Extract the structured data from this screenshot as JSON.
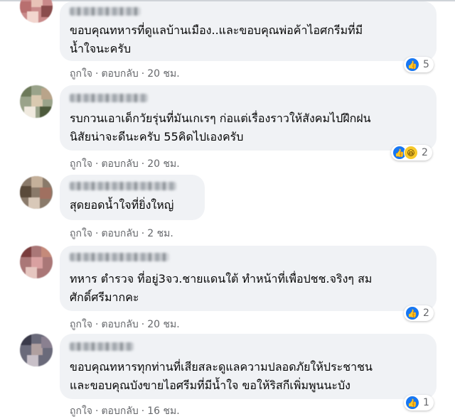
{
  "colors": {
    "bubble": "#f0f2f5",
    "meta": "#65676b",
    "like": "#1877f2",
    "haha": "#f7c92a"
  },
  "icons": {
    "like": "like-reaction-icon",
    "haha": "haha-reaction-icon"
  },
  "comments": [
    {
      "text": "ขอบคุณทหารที่ดูแลบ้านเมือง..และขอบคุณพ่อค้าไอศกรีมที่มี\nน้ำใจนะครับ",
      "like": "ถูกใจ",
      "reply": "ตอบกลับ",
      "time": "20 ชม.",
      "reaction_count": "5"
    },
    {
      "text": "รบกวนเอาเด็กวัยรุ่นที่มันเกเรๆ ก่อแต่เรื่องราวให้สังคมไปฝึกฝน\nนิสัยน่าจะดีนะครับ 55คิดไปเองครับ",
      "like": "ถูกใจ",
      "reply": "ตอบกลับ",
      "time": "20 ชม.",
      "reaction_count": "2"
    },
    {
      "text": "สุดยอดน้ำใจที่ยิ่งใหญ่",
      "like": "ถูกใจ",
      "reply": "ตอบกลับ",
      "time": "2 ชม."
    },
    {
      "text": "ทหาร ตำรวจ ที่อยู่3จว.ชายแดนใต้ ทำหน้าที่เพื่อปชช.จริงๆ สม\nศักดิ์ศรีมากคะ",
      "like": "ถูกใจ",
      "reply": "ตอบกลับ",
      "time": "20 ชม.",
      "reaction_count": "2"
    },
    {
      "text": "ขอบคุณทหารทุกท่านที่เสียสละดูแลความปลอดภัยให้ประชาชน\nและขอบคุณบังขายไอศรีมที่มีน้ำใจ ขอให้ริสกีเพิ่มพูนนะบัง",
      "like": "ถูกใจ",
      "reply": "ตอบกลับ",
      "time": "16 ชม.",
      "reaction_count": "1"
    }
  ]
}
